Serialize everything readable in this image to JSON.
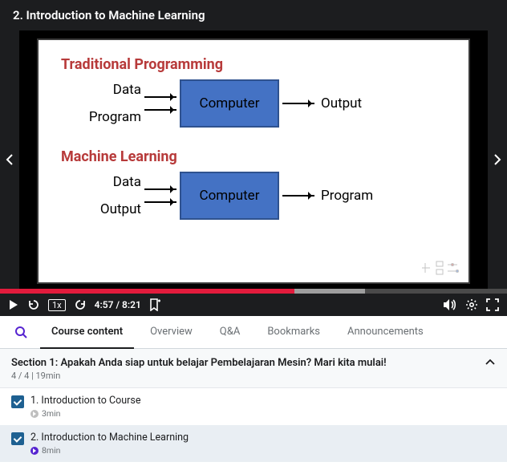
{
  "header": {
    "lecture_title": "2. Introduction to Machine Learning"
  },
  "slide": {
    "section1_title": "Traditional Programming",
    "sec1_in1": "Data",
    "sec1_in2": "Program",
    "sec1_box": "Computer",
    "sec1_out": "Output",
    "section2_title": "Machine Learning",
    "sec2_in1": "Data",
    "sec2_in2": "Output",
    "sec2_box": "Computer",
    "sec2_out": "Program"
  },
  "progress": {
    "played_pct": 58,
    "buffered_pct": 14
  },
  "controls": {
    "rate": "1x",
    "current_time": "4:57",
    "duration": "8:21"
  },
  "tabs": {
    "content": "Course content",
    "overview": "Overview",
    "qa": "Q&A",
    "bookmarks": "Bookmarks",
    "announcements": "Announcements"
  },
  "section": {
    "title": "Section 1: Apakah Anda siap untuk belajar Pembelajaran Mesin? Mari kita mulai!",
    "meta": "4 / 4 | 19min"
  },
  "lessons": [
    {
      "title": "1. Introduction to Course",
      "duration": "3min"
    },
    {
      "title": "2. Introduction to Machine Learning",
      "duration": "8min"
    }
  ]
}
